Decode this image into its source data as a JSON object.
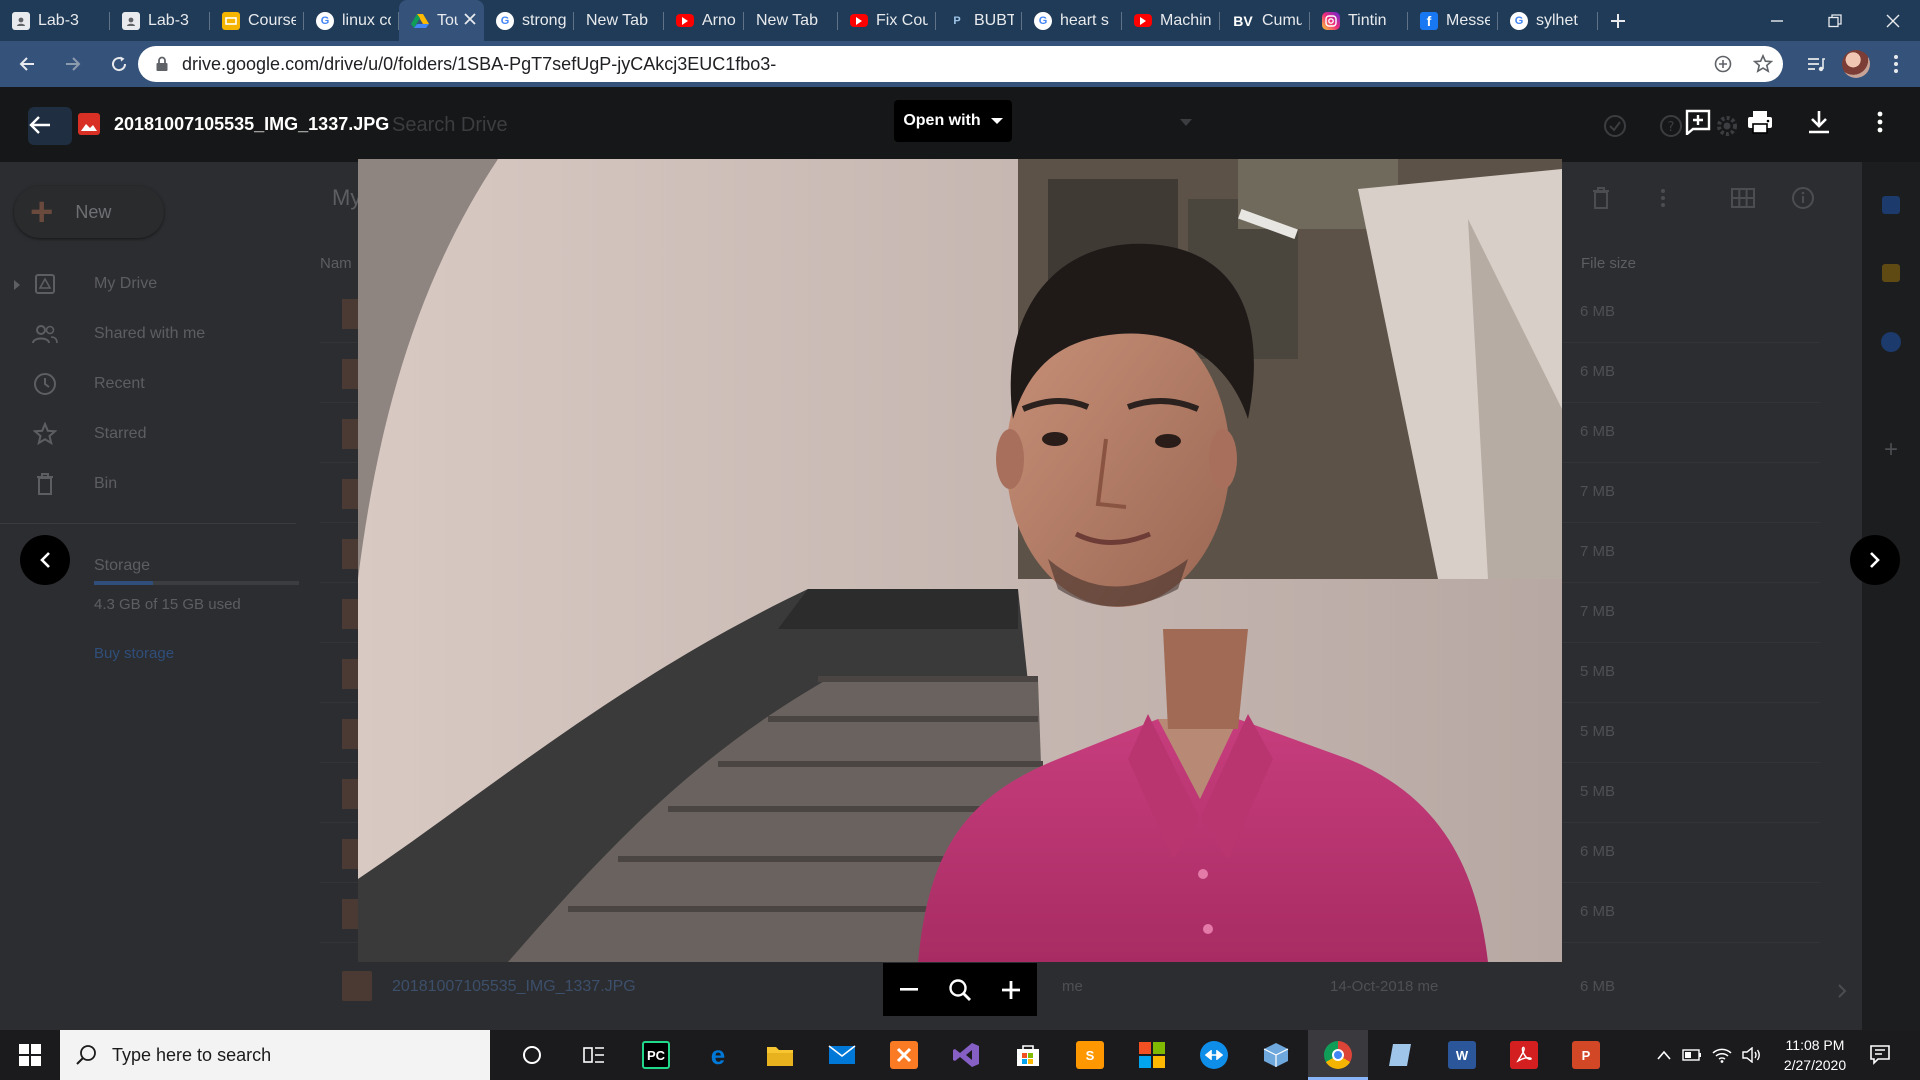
{
  "browser": {
    "tabs": [
      {
        "title": "Lab-3",
        "icon": "classroom-icon",
        "color": "#5f6368"
      },
      {
        "title": "Lab-3",
        "icon": "classroom-icon",
        "color": "#5f6368"
      },
      {
        "title": "Course",
        "icon": "slides-icon",
        "color": "#f4b400"
      },
      {
        "title": "linux cc",
        "icon": "google-icon",
        "color": "#ffffff"
      },
      {
        "title": "Tou",
        "icon": "drive-icon",
        "color": "#0f9d58",
        "active": true
      },
      {
        "title": "strong",
        "icon": "google-icon",
        "color": "#ffffff"
      },
      {
        "title": "New Tab",
        "icon": "",
        "color": ""
      },
      {
        "title": "Arnob",
        "icon": "youtube-icon",
        "color": "#ff0000"
      },
      {
        "title": "New Tab",
        "icon": "",
        "color": ""
      },
      {
        "title": "Fix Cou",
        "icon": "youtube-icon",
        "color": "#ff0000"
      },
      {
        "title": "BUBT A",
        "icon": "bubt-icon",
        "color": "#4a6fa5"
      },
      {
        "title": "heart s",
        "icon": "google-icon",
        "color": "#ffffff"
      },
      {
        "title": "Machin",
        "icon": "youtube-icon",
        "color": "#ff0000"
      },
      {
        "title": "Cumul",
        "icon": "bv-icon",
        "color": "#1f3b57"
      },
      {
        "title": "Tintin",
        "icon": "instagram-icon",
        "color": "#e1306c"
      },
      {
        "title": "Messe",
        "icon": "facebook-icon",
        "color": "#1877f2"
      },
      {
        "title": "sylhet",
        "icon": "google-icon",
        "color": "#ffffff"
      }
    ],
    "url": "drive.google.com/drive/u/0/folders/1SBA-PgT7sefUgP-jyCAkcj3EUC1fbo3-"
  },
  "viewer": {
    "filename": "20181007105535_IMG_1337.JPG",
    "open_with_label": "Open with"
  },
  "drive_bg": {
    "search_placeholder": "Search Drive",
    "new_label": "New",
    "list_title": "My",
    "nav": [
      {
        "label": "My Drive",
        "icon": "drive-folder-icon"
      },
      {
        "label": "Shared with me",
        "icon": "people-icon"
      },
      {
        "label": "Recent",
        "icon": "clock-icon"
      },
      {
        "label": "Starred",
        "icon": "star-icon"
      },
      {
        "label": "Bin",
        "icon": "trash-icon"
      }
    ],
    "storage_label": "Storage",
    "storage_used": "4.3 GB of 15 GB used",
    "storage_fraction": 0.29,
    "buy_storage": "Buy storage",
    "col_name": "Nam",
    "col_size": "File size",
    "rows": [
      {
        "size": "6 MB"
      },
      {
        "size": "6 MB"
      },
      {
        "size": "6 MB"
      },
      {
        "size": "7 MB"
      },
      {
        "size": "7 MB"
      },
      {
        "size": "7 MB"
      },
      {
        "size": "5 MB"
      },
      {
        "size": "5 MB"
      },
      {
        "size": "5 MB"
      },
      {
        "size": "6 MB"
      },
      {
        "size": "6 MB"
      }
    ],
    "last_row": {
      "name": "20181007105535_IMG_1337.JPG",
      "owner": "me",
      "modified": "14-Oct-2018 me",
      "size": "6 MB"
    }
  },
  "taskbar": {
    "search_placeholder": "Type here to search",
    "apps": [
      {
        "name": "cortana-icon",
        "label": "",
        "color": ""
      },
      {
        "name": "task-view-icon",
        "label": "",
        "color": ""
      },
      {
        "name": "pycharm-icon",
        "label": "PC",
        "color": "#21d789"
      },
      {
        "name": "edge-icon",
        "label": "e",
        "color": "#0078d7"
      },
      {
        "name": "file-explorer-icon",
        "label": "",
        "color": "#f8c630"
      },
      {
        "name": "mail-icon",
        "label": "",
        "color": "#0078d7"
      },
      {
        "name": "xampp-icon",
        "label": "",
        "color": "#fb7a24"
      },
      {
        "name": "visual-studio-icon",
        "label": "",
        "color": "#865fc5"
      },
      {
        "name": "store-icon",
        "label": "",
        "color": "#ffffff"
      },
      {
        "name": "sublime-text-icon",
        "label": "S",
        "color": "#ff9800"
      },
      {
        "name": "ms-office-icon",
        "label": "",
        "color": "#e74c3c"
      },
      {
        "name": "teamviewer-icon",
        "label": "",
        "color": "#0e8ee9"
      },
      {
        "name": "virtualbox-icon",
        "label": "",
        "color": "#6fa8dc"
      },
      {
        "name": "chrome-icon",
        "label": "",
        "color": "#4caf50",
        "active": true
      },
      {
        "name": "app-icon",
        "label": "",
        "color": "#9fc5e8"
      },
      {
        "name": "word-icon",
        "label": "W",
        "color": "#2b579a"
      },
      {
        "name": "acrobat-icon",
        "label": "",
        "color": "#d31f1f"
      },
      {
        "name": "powerpoint-icon",
        "label": "P",
        "color": "#d24726"
      }
    ],
    "time": "11:08 PM",
    "date": "2/27/2020"
  }
}
